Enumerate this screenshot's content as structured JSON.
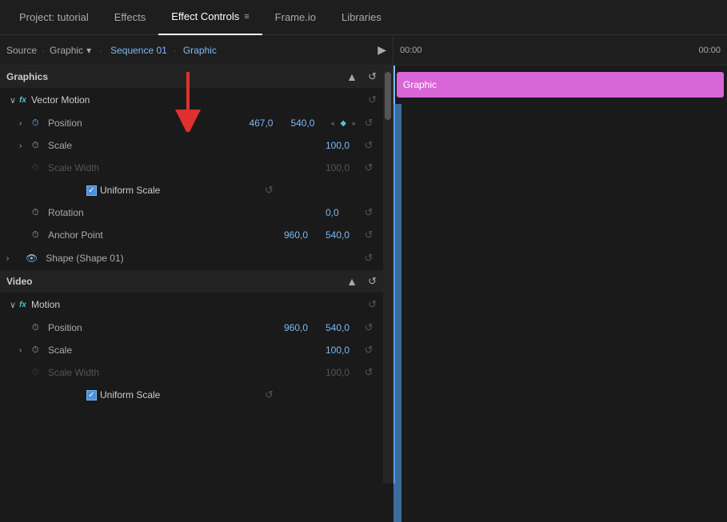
{
  "tabs": [
    {
      "id": "project",
      "label": "Project: tutorial",
      "active": false
    },
    {
      "id": "effects",
      "label": "Effects",
      "active": false
    },
    {
      "id": "effect-controls",
      "label": "Effect Controls",
      "active": true
    },
    {
      "id": "frameio",
      "label": "Frame.io",
      "active": false
    },
    {
      "id": "libraries",
      "label": "Libraries",
      "active": false
    }
  ],
  "source": {
    "prefix": "Source",
    "dot": "·",
    "item": "Graphic",
    "dropdown_icon": "▾",
    "sequence": "Sequence 01",
    "seq_dot": "·",
    "seq_item": "Graphic"
  },
  "graphics_section": {
    "title": "Graphics",
    "scroll_icon": "▲"
  },
  "vector_motion": {
    "fx_label": "fx",
    "name": "Vector Motion"
  },
  "properties": {
    "position": {
      "label": "Position",
      "val1": "467,0",
      "val2": "540,0",
      "has_keyframe": true
    },
    "scale": {
      "label": "Scale",
      "val1": "100,0"
    },
    "scale_width": {
      "label": "Scale Width",
      "val1": "100,0",
      "disabled": true
    },
    "uniform_scale": {
      "label": "Uniform Scale",
      "checked": true
    },
    "rotation": {
      "label": "Rotation",
      "val1": "0,0"
    },
    "anchor_point": {
      "label": "Anchor Point",
      "val1": "960,0",
      "val2": "540,0"
    },
    "shape": {
      "label": "Shape (Shape 01)"
    },
    "video_position": {
      "label": "Position",
      "val1": "960,0",
      "val2": "540,0"
    },
    "video_scale": {
      "label": "Scale",
      "val1": "100,0"
    },
    "video_scale_width": {
      "label": "Scale Width",
      "val1": "100,0",
      "disabled": true
    },
    "video_uniform_scale": {
      "label": "Uniform Scale",
      "checked": true
    }
  },
  "video_section": {
    "title": "Video"
  },
  "motion": {
    "fx_label": "fx",
    "name": "Motion"
  },
  "timeline": {
    "start_time": "00:00",
    "end_time": "00:00",
    "graphic_label": "Graphic"
  },
  "icons": {
    "play": "▶",
    "scroll_up": "▲",
    "reset": "↺",
    "expand": "›",
    "collapse": "∨",
    "check": "✓",
    "nav_left": "◄",
    "nav_right": "►",
    "diamond": "◆",
    "menu": "≡"
  }
}
